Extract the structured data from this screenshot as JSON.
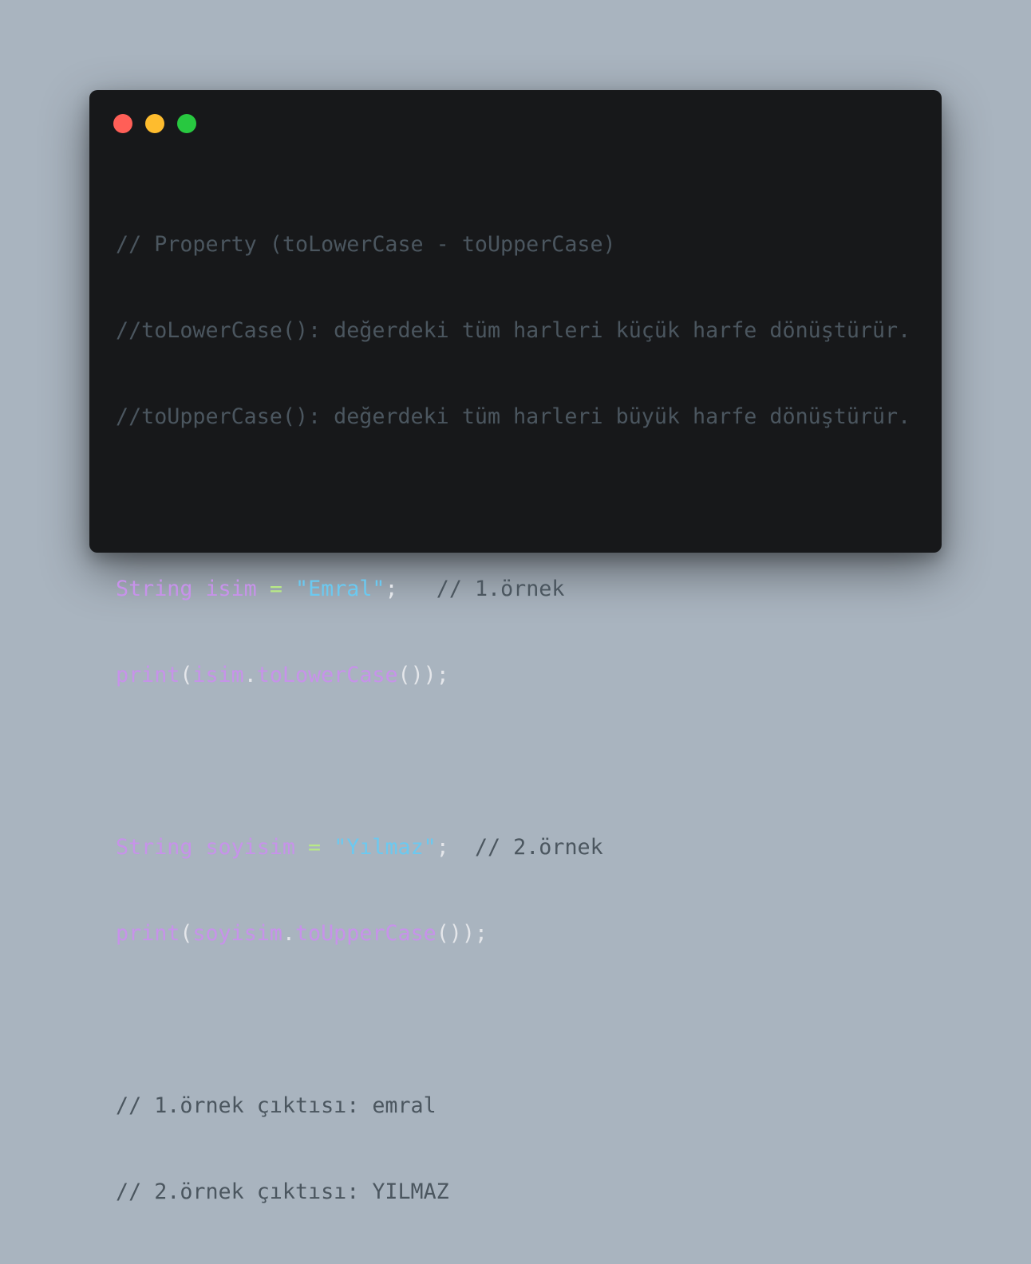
{
  "window": {
    "controls": {
      "close_color": "#ff5f57",
      "minimize_color": "#febc2e",
      "maximize_color": "#28c840"
    }
  },
  "code": {
    "line1": "// Property (toLowerCase - toUpperCase)",
    "line2": "//toLowerCase(): değerdeki tüm harleri küçük harfe dönüştürür.",
    "line3": "//toUpperCase(): değerdeki tüm harleri büyük harfe dönüştürür.",
    "line5": {
      "type": "String",
      "name": "isim",
      "op": "=",
      "value": "\"Emral\"",
      "semi": ";",
      "comment": "// 1.örnek"
    },
    "line6": {
      "fn": "print",
      "open": "(",
      "target": "isim",
      "dot": ".",
      "method": "toLowerCase",
      "close": "());"
    },
    "line8": {
      "type": "String",
      "name": "soyisim",
      "op": "=",
      "value": "\"Yılmaz\"",
      "semi": ";",
      "comment": "// 2.örnek"
    },
    "line9": {
      "fn": "print",
      "open": "(",
      "target": "soyisim",
      "dot": ".",
      "method": "toUpperCase",
      "close": "());"
    },
    "line11": "// 1.örnek çıktısı: emral",
    "line12": "// 2.örnek çıktısı: YILMAZ"
  }
}
